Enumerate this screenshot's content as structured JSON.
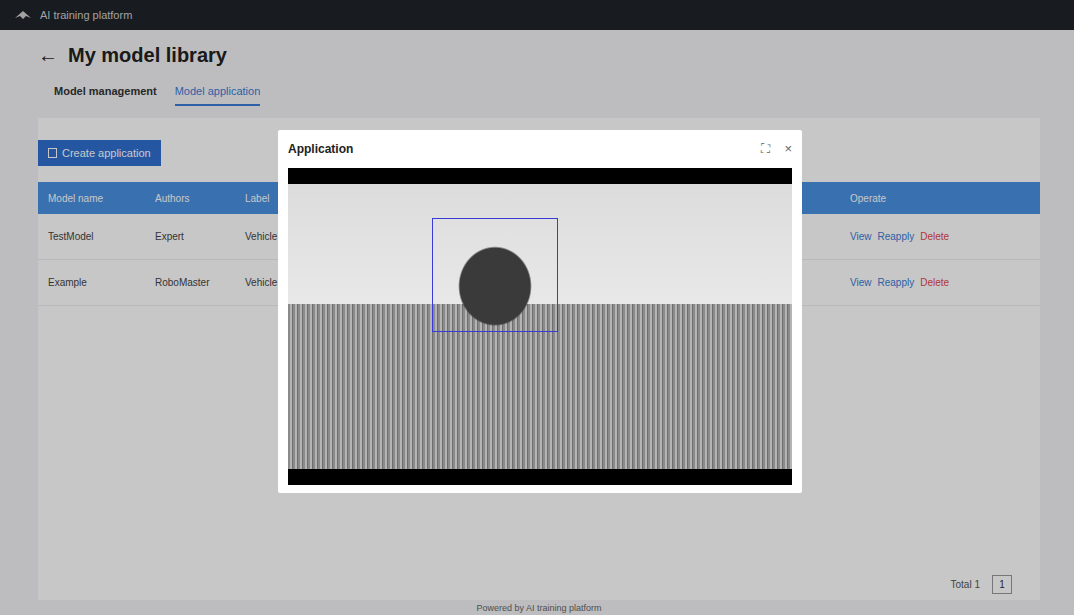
{
  "window": {
    "title": "AI training platform"
  },
  "page": {
    "back": "←",
    "title": "My model library"
  },
  "tabs": [
    {
      "label": "Model management",
      "selected": false
    },
    {
      "label": "Model application",
      "selected": true
    }
  ],
  "toolbar": {
    "create": "Create application"
  },
  "table": {
    "columns": [
      "Model name",
      "Authors",
      "Label",
      "Operate"
    ],
    "rows": [
      {
        "cells": [
          "TestModel",
          "Expert",
          "Vehicle"
        ],
        "actions": [
          {
            "label": "View",
            "color": "#3a7bd5"
          },
          {
            "label": "Reapply",
            "color": "#3a7bd5"
          },
          {
            "label": "Delete",
            "color": "#e04848"
          }
        ]
      },
      {
        "cells": [
          "Example",
          "RoboMaster",
          "Vehicle"
        ],
        "actions": [
          {
            "label": "View",
            "color": "#3a7bd5"
          },
          {
            "label": "Reapply",
            "color": "#3a7bd5"
          },
          {
            "label": "Delete",
            "color": "#e04848"
          }
        ]
      }
    ]
  },
  "pagination": {
    "total": "Total 1",
    "page": "1"
  },
  "footer": "Powered by AI training platform",
  "modal": {
    "title": "Application",
    "expand": "⛶",
    "close": "×"
  }
}
